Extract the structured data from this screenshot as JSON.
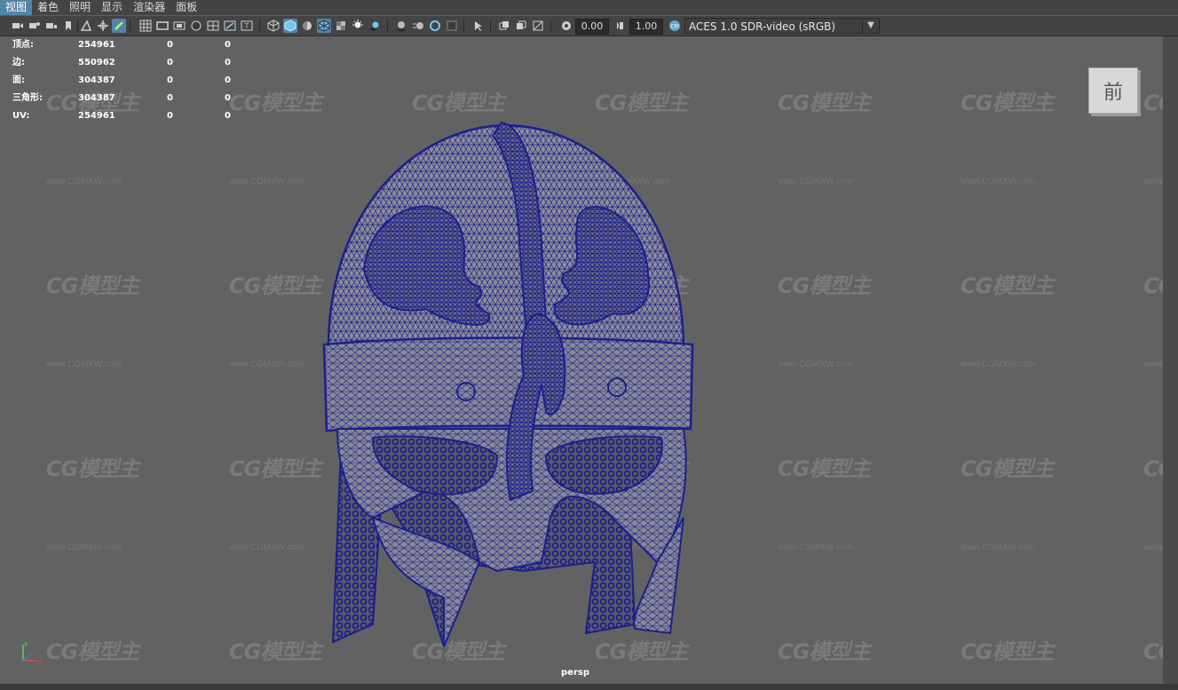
{
  "menu": [
    "视图",
    "着色",
    "照明",
    "显示",
    "渲染器",
    "面板"
  ],
  "toolbar": {
    "exposure_value": "0.00",
    "gamma_value": "1.00",
    "color_space": "ACES 1.0 SDR-video (sRGB)"
  },
  "hud": [
    {
      "label": "顶点:",
      "v1": "254961",
      "v2": "0",
      "v3": "0"
    },
    {
      "label": "边:",
      "v1": "550962",
      "v2": "0",
      "v3": "0"
    },
    {
      "label": "面:",
      "v1": "304387",
      "v2": "0",
      "v3": "0"
    },
    {
      "label": "三角形:",
      "v1": "304387",
      "v2": "0",
      "v3": "0"
    },
    {
      "label": "UV:",
      "v1": "254961",
      "v2": "0",
      "v3": "0"
    }
  ],
  "viewcube_label": "前",
  "camera_label": "persp",
  "watermark": {
    "logo": "CG模型主",
    "url": "www.CGMXW.com"
  },
  "colors": {
    "wireframe": "#1c1f8c",
    "shaded": "#8c8c96",
    "accent": "#5285a6"
  }
}
